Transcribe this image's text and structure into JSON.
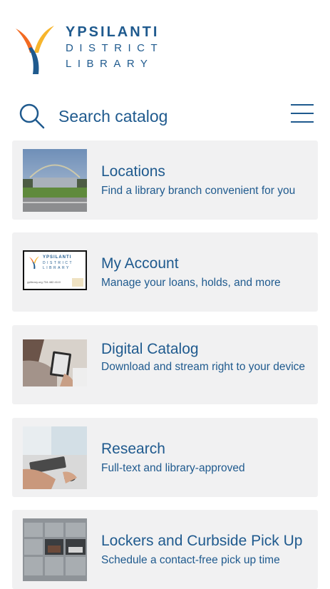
{
  "logo": {
    "line1": "YPSILANTI",
    "line2": "DISTRICT",
    "line3": "LIBRARY"
  },
  "search": {
    "placeholder": "Search catalog"
  },
  "cards": [
    {
      "title": "Locations",
      "description": "Find a library branch convenient for you"
    },
    {
      "title": "My Account",
      "description": "Manage your loans, holds, and more",
      "thumb": {
        "line1": "YPSILANTI",
        "line2": "DISTRICT",
        "line3": "LIBRARY",
        "footer": "yplibrary.org   734.482.4110"
      }
    },
    {
      "title": "Digital Catalog",
      "description": "Download and stream right to your device"
    },
    {
      "title": "Research",
      "description": "Full-text and library-approved"
    },
    {
      "title": "Lockers and Curbside Pick Up",
      "description": "Schedule a contact-free pick up time"
    }
  ],
  "colors": {
    "brand_blue": "#1f5a8e",
    "card_bg": "#f1f1f2",
    "logo_orange": "#f26a21",
    "logo_yellow": "#f7b52c"
  }
}
